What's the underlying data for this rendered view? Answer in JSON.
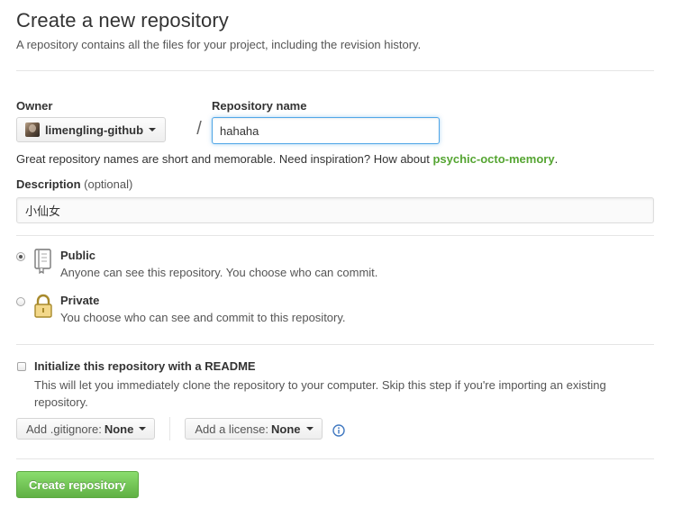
{
  "header": {
    "title": "Create a new repository",
    "subtitle": "A repository contains all the files for your project, including the revision history."
  },
  "owner": {
    "label": "Owner",
    "value": "limengling-github"
  },
  "separator": "/",
  "repository": {
    "label": "Repository name",
    "value": "hahaha",
    "focused": true
  },
  "hint": {
    "text": "Great repository names are short and memorable. Need inspiration? How about ",
    "suggestion": "psychic-octo-memory",
    "suffix": "."
  },
  "description": {
    "label": "Description",
    "optional": "(optional)",
    "value": "小仙女"
  },
  "visibility": {
    "selected": "public",
    "public": {
      "title": "Public",
      "description": "Anyone can see this repository. You choose who can commit."
    },
    "private": {
      "title": "Private",
      "description": "You choose who can see and commit to this repository."
    }
  },
  "readme": {
    "checked": false,
    "title": "Initialize this repository with a README",
    "description": "This will let you immediately clone the repository to your computer. Skip this step if you're importing an existing repository."
  },
  "gitignore": {
    "label": "Add .gitignore:",
    "value": "None"
  },
  "license": {
    "label": "Add a license:",
    "value": "None"
  },
  "submit": {
    "label": "Create repository"
  },
  "colors": {
    "suggestion": "#55a532",
    "primary_button": "#60b044",
    "focus_border": "#51a7e8",
    "info_icon": "#4078c0"
  },
  "icons": {
    "public": "repo-book-icon",
    "private": "lock-icon",
    "license_info": "info-icon",
    "dropdown": "caret-down-icon"
  }
}
